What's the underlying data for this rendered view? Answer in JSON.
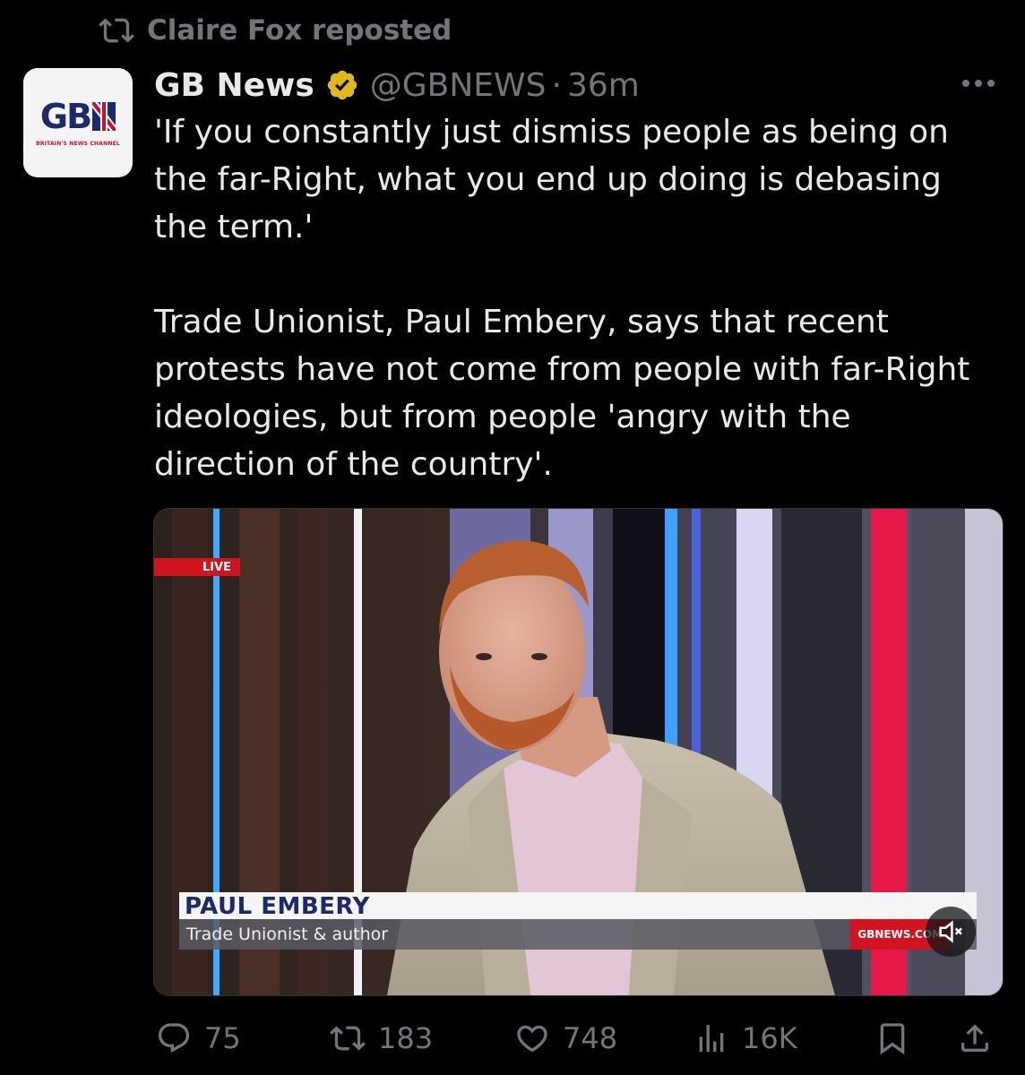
{
  "repost": {
    "text": "Claire Fox reposted",
    "icon": "repost-icon"
  },
  "author": {
    "display_name": "GB News",
    "handle": "@GBNEWS",
    "separator": "·",
    "time": "36m",
    "verified_color": "#e2b719",
    "avatar": {
      "logo_text": "GB",
      "tagline": "BRITAIN'S NEWS CHANNEL"
    }
  },
  "tweet": {
    "paragraph1": "'If you constantly just dismiss people as being on the far-Right, what you end up doing is debasing the term.'",
    "paragraph2": "Trade Unionist, Paul Embery, says that recent protests have not come from people with far-Right ideologies, but from people 'angry with the direction of the country'."
  },
  "video": {
    "live_label": "LIVE",
    "lower_third_name": "PAUL EMBERY",
    "lower_third_role": "Trade Unionist & author",
    "brand": "GBNEWS.COM",
    "mute_icon": "speaker-muted-icon"
  },
  "actions": {
    "replies": "75",
    "reposts": "183",
    "likes": "748",
    "views": "16K"
  },
  "colors": {
    "background": "#000000",
    "text": "#e7e9ea",
    "muted": "#71767b",
    "brand_red": "#d1141f",
    "brand_navy": "#1b2a6b"
  }
}
